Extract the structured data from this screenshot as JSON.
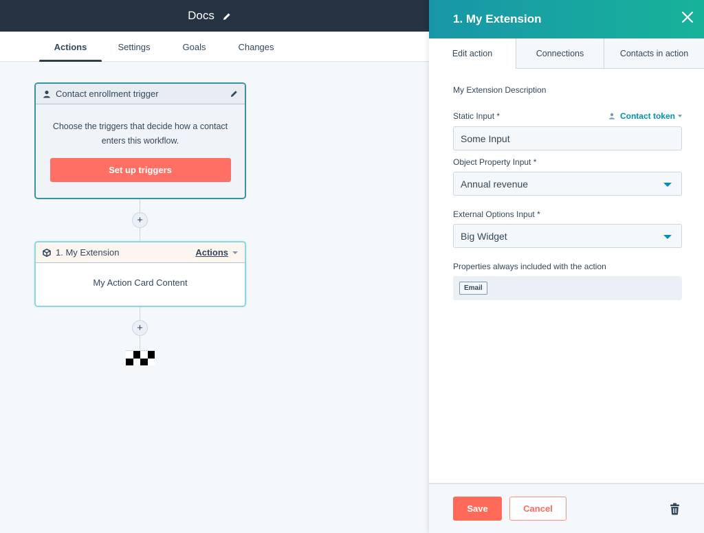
{
  "workflow": {
    "title": "Docs",
    "tabs": [
      {
        "label": "Actions",
        "active": true
      },
      {
        "label": "Settings",
        "active": false
      },
      {
        "label": "Goals",
        "active": false
      },
      {
        "label": "Changes",
        "active": false
      }
    ]
  },
  "trigger_card": {
    "title": "Contact enrollment trigger",
    "description_line1": "Choose the triggers that decide how a contact",
    "description_line2": "enters this workflow.",
    "button_label": "Set up triggers"
  },
  "action_card": {
    "title": "1. My Extension",
    "actions_label": "Actions",
    "content": "My Action Card Content"
  },
  "add_buttons": [
    "+",
    "+"
  ],
  "panel": {
    "title": "1. My Extension",
    "tabs": [
      {
        "label": "Edit action",
        "active": true
      },
      {
        "label": "Connections",
        "active": false
      },
      {
        "label": "Contacts in action",
        "active": false
      }
    ],
    "description": "My Extension Description",
    "fields": {
      "static_input": {
        "label": "Static Input *",
        "value": "Some Input",
        "token_label": "Contact token"
      },
      "object_property": {
        "label": "Object Property Input *",
        "value": "Annual revenue"
      },
      "external_options": {
        "label": "External Options Input *",
        "value": "Big Widget"
      }
    },
    "properties": {
      "label": "Properties always included with the action",
      "chips": [
        "Email"
      ]
    },
    "footer": {
      "save_label": "Save",
      "cancel_label": "Cancel"
    }
  },
  "colors": {
    "topbar": "#253342",
    "accent_teal": "#0091ae",
    "primary_orange": "#ff6a59",
    "trigger_border": "#3c8ea2",
    "action_border": "#8fd6df"
  }
}
